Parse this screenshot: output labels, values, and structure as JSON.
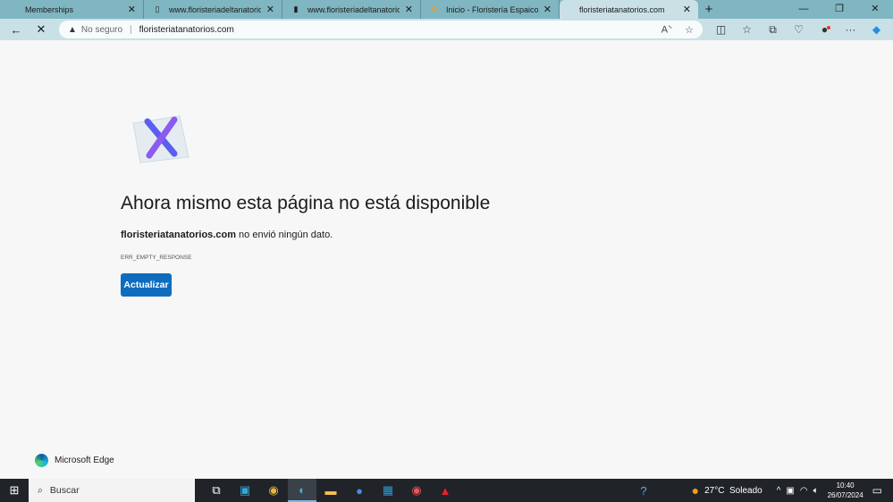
{
  "tabs": [
    {
      "label": "Memberships",
      "icon": "globe-icon"
    },
    {
      "label": "www.floristeriadeltanatorio.es",
      "icon": "page-icon"
    },
    {
      "label": "www.floristeriadeltanatorio.es",
      "icon": "page-icon"
    },
    {
      "label": "Inicio - Floristería Espaicol",
      "icon": "flower-icon"
    },
    {
      "label": "floristeriatanatorios.com",
      "icon": "none",
      "active": true
    }
  ],
  "address": {
    "security": "No seguro",
    "url": "floristeriatanatorios.com"
  },
  "error": {
    "title": "Ahora mismo esta página no está disponible",
    "domain": "floristeriatanatorios.com",
    "message": " no envió ningún dato.",
    "code": "ERR_EMPTY_RESPONSE",
    "button": "Actualizar"
  },
  "brand": "Microsoft Edge",
  "taskbar": {
    "search": "Buscar",
    "weather": "27°C  Soleado",
    "time": "10:40",
    "date": "26/07/2024"
  },
  "colors": {
    "accent": "#0f6cbd",
    "tabbar": "#7fb6c1",
    "toolbar": "#c9e1e6"
  }
}
